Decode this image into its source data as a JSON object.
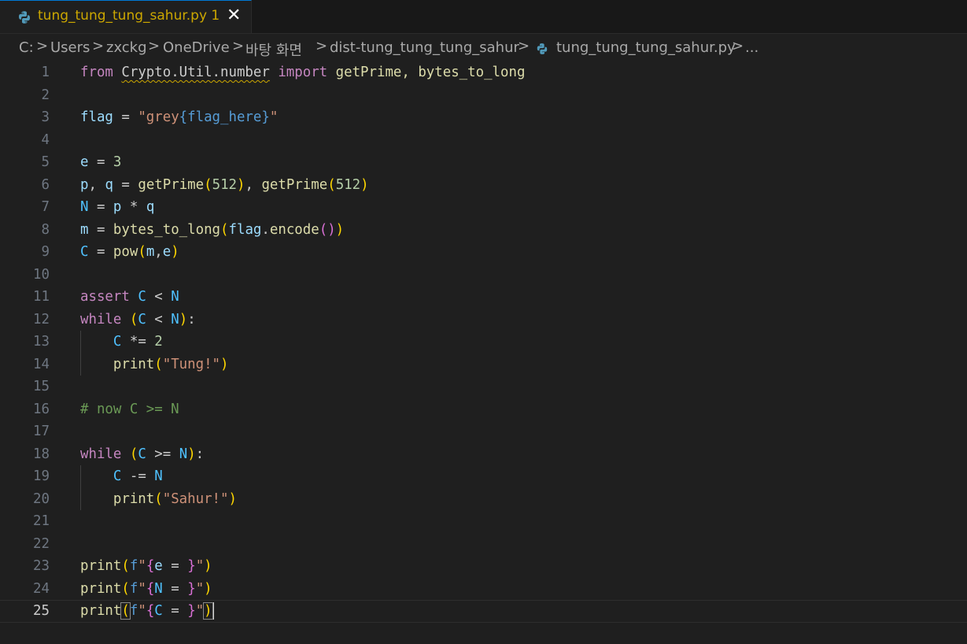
{
  "tab": {
    "title": "tung_tung_tung_sahur.py 1",
    "close_glyph": "✕",
    "icon": "python-icon",
    "modified_color": "#cca700"
  },
  "breadcrumb": {
    "items": [
      "C:",
      "Users",
      "zxckg",
      "OneDrive",
      "바탕 화면",
      "dist-tung_tung_tung_sahur",
      "tung_tung_tung_sahur.py",
      "..."
    ],
    "separator": ">"
  },
  "colors": {
    "keyword": "#c586c0",
    "variable": "#9cdcfe",
    "constant": "#4fc1ff",
    "function": "#dcdcaa",
    "string": "#ce9178",
    "number": "#b5cea8",
    "comment": "#6a9955",
    "bracket1": "#ffd700",
    "bracket2": "#da70d6",
    "format_brace": "#569cd6",
    "fstring_prefix": "#569cd6"
  },
  "editor": {
    "current_line": 25,
    "lines": [
      {
        "number": "1",
        "tokens": [
          [
            "from",
            "keyword"
          ],
          [
            " ",
            ""
          ],
          [
            "Crypto.Util.number",
            "module"
          ],
          [
            " ",
            ""
          ],
          [
            "import",
            "keyword"
          ],
          [
            " getPrime, bytes_to_long",
            "function"
          ]
        ]
      },
      {
        "number": "2",
        "tokens": []
      },
      {
        "number": "3",
        "tokens": [
          [
            "flag",
            "variable"
          ],
          [
            " = ",
            ""
          ],
          [
            "\"grey",
            "string"
          ],
          [
            "{flag_here}",
            "format"
          ],
          [
            "\"",
            "string"
          ]
        ]
      },
      {
        "number": "4",
        "tokens": []
      },
      {
        "number": "5",
        "tokens": [
          [
            "e",
            "variable"
          ],
          [
            " = ",
            ""
          ],
          [
            "3",
            "number"
          ]
        ]
      },
      {
        "number": "6",
        "tokens": [
          [
            "p",
            "variable"
          ],
          [
            ", ",
            ""
          ],
          [
            "q",
            "variable"
          ],
          [
            " = ",
            ""
          ],
          [
            "getPrime",
            "function"
          ],
          [
            "(",
            "bracket1"
          ],
          [
            "512",
            "number"
          ],
          [
            ")",
            "bracket1"
          ],
          [
            ", ",
            ""
          ],
          [
            "getPrime",
            "function"
          ],
          [
            "(",
            "bracket1"
          ],
          [
            "512",
            "number"
          ],
          [
            ")",
            "bracket1"
          ]
        ]
      },
      {
        "number": "7",
        "tokens": [
          [
            "N",
            "constant"
          ],
          [
            " = ",
            ""
          ],
          [
            "p",
            "variable"
          ],
          [
            " * ",
            ""
          ],
          [
            "q",
            "variable"
          ]
        ]
      },
      {
        "number": "8",
        "tokens": [
          [
            "m",
            "variable"
          ],
          [
            " = ",
            ""
          ],
          [
            "bytes_to_long",
            "function"
          ],
          [
            "(",
            "bracket1"
          ],
          [
            "flag",
            "variable"
          ],
          [
            ".",
            ""
          ],
          [
            "encode",
            "function"
          ],
          [
            "()",
            "bracket2"
          ],
          [
            ")",
            "bracket1"
          ]
        ]
      },
      {
        "number": "9",
        "tokens": [
          [
            "C",
            "constant"
          ],
          [
            " = ",
            ""
          ],
          [
            "pow",
            "function"
          ],
          [
            "(",
            "bracket1"
          ],
          [
            "m",
            "variable"
          ],
          [
            ",",
            ""
          ],
          [
            "e",
            "variable"
          ],
          [
            ")",
            "bracket1"
          ]
        ]
      },
      {
        "number": "10",
        "tokens": []
      },
      {
        "number": "11",
        "tokens": [
          [
            "assert",
            "keyword"
          ],
          [
            " ",
            ""
          ],
          [
            "C",
            "constant"
          ],
          [
            " < ",
            ""
          ],
          [
            "N",
            "constant"
          ]
        ]
      },
      {
        "number": "12",
        "tokens": [
          [
            "while",
            "keyword"
          ],
          [
            " ",
            ""
          ],
          [
            "(",
            "bracket1"
          ],
          [
            "C",
            "constant"
          ],
          [
            " < ",
            ""
          ],
          [
            "N",
            "constant"
          ],
          [
            ")",
            "bracket1"
          ],
          [
            ":",
            ""
          ]
        ]
      },
      {
        "number": "13",
        "tokens": [
          [
            "    ",
            ""
          ],
          [
            "C",
            "constant"
          ],
          [
            " *= ",
            ""
          ],
          [
            "2",
            "number"
          ]
        ]
      },
      {
        "number": "14",
        "tokens": [
          [
            "    ",
            ""
          ],
          [
            "print",
            "function"
          ],
          [
            "(",
            "bracket1"
          ],
          [
            "\"Tung!\"",
            "string"
          ],
          [
            ")",
            "bracket1"
          ]
        ]
      },
      {
        "number": "15",
        "tokens": []
      },
      {
        "number": "16",
        "tokens": [
          [
            "# now C >= N",
            "comment"
          ]
        ]
      },
      {
        "number": "17",
        "tokens": []
      },
      {
        "number": "18",
        "tokens": [
          [
            "while",
            "keyword"
          ],
          [
            " ",
            ""
          ],
          [
            "(",
            "bracket1"
          ],
          [
            "C",
            "constant"
          ],
          [
            " >= ",
            ""
          ],
          [
            "N",
            "constant"
          ],
          [
            ")",
            "bracket1"
          ],
          [
            ":",
            ""
          ]
        ]
      },
      {
        "number": "19",
        "tokens": [
          [
            "    ",
            ""
          ],
          [
            "C",
            "constant"
          ],
          [
            " -= ",
            ""
          ],
          [
            "N",
            "constant"
          ]
        ]
      },
      {
        "number": "20",
        "tokens": [
          [
            "    ",
            ""
          ],
          [
            "print",
            "function"
          ],
          [
            "(",
            "bracket1"
          ],
          [
            "\"Sahur!\"",
            "string"
          ],
          [
            ")",
            "bracket1"
          ]
        ]
      },
      {
        "number": "21",
        "tokens": []
      },
      {
        "number": "22",
        "tokens": []
      },
      {
        "number": "23",
        "tokens": [
          [
            "print",
            "function"
          ],
          [
            "(",
            "bracket1"
          ],
          [
            "f",
            "fprefix"
          ],
          [
            "\"",
            "string"
          ],
          [
            "{",
            "bracket2"
          ],
          [
            "e",
            "variable"
          ],
          [
            " = ",
            ""
          ],
          [
            "}",
            "bracket2"
          ],
          [
            "\"",
            "string"
          ],
          [
            ")",
            "bracket1"
          ]
        ]
      },
      {
        "number": "24",
        "tokens": [
          [
            "print",
            "function"
          ],
          [
            "(",
            "bracket1"
          ],
          [
            "f",
            "fprefix"
          ],
          [
            "\"",
            "string"
          ],
          [
            "{",
            "bracket2"
          ],
          [
            "N",
            "constant"
          ],
          [
            " = ",
            ""
          ],
          [
            "}",
            "bracket2"
          ],
          [
            "\"",
            "string"
          ],
          [
            ")",
            "bracket1"
          ]
        ]
      },
      {
        "number": "25",
        "tokens": [
          [
            "print",
            "function"
          ],
          [
            "(",
            "bracket1m"
          ],
          [
            "f",
            "fprefix"
          ],
          [
            "\"",
            "string"
          ],
          [
            "{",
            "bracket2"
          ],
          [
            "C",
            "constant"
          ],
          [
            " = ",
            ""
          ],
          [
            "}",
            "bracket2"
          ],
          [
            "\"",
            "string"
          ],
          [
            ")",
            "bracket1m"
          ]
        ]
      }
    ]
  }
}
